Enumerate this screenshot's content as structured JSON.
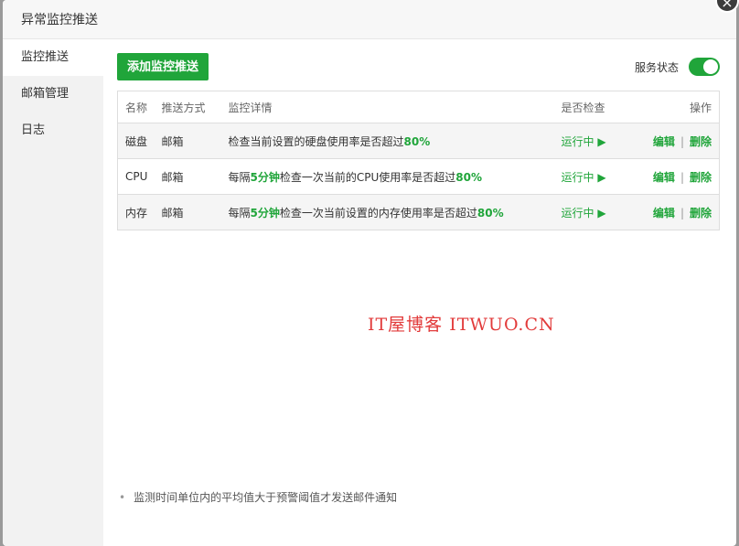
{
  "dialog": {
    "title": "异常监控推送",
    "close_icon": "close-icon"
  },
  "sidebar": {
    "items": [
      {
        "label": "监控推送"
      },
      {
        "label": "邮箱管理"
      },
      {
        "label": "日志"
      }
    ]
  },
  "toolbar": {
    "add_label": "添加监控推送",
    "service_label": "服务状态",
    "service_on": true
  },
  "table": {
    "headers": [
      "名称",
      "推送方式",
      "监控详情",
      "是否检查",
      "操作"
    ],
    "rows": [
      {
        "name": "磁盘",
        "type": "邮箱",
        "detail_a": "检查当前设置的硬盘使用率是否超过",
        "detail_hl": "80%",
        "detail_b": "",
        "detail_c": "",
        "status": "运行中 ▶",
        "edit": "编辑",
        "sep": "|",
        "del": "删除"
      },
      {
        "name": "CPU",
        "type": "邮箱",
        "detail_a": "每隔",
        "detail_hl": "5分钟",
        "detail_b": "检查一次当前的CPU使用率是否超过",
        "detail_c": "80%",
        "status": "运行中 ▶",
        "edit": "编辑",
        "sep": "|",
        "del": "删除"
      },
      {
        "name": "内存",
        "type": "邮箱",
        "detail_a": "每隔",
        "detail_hl": "5分钟",
        "detail_b": "检查一次当前设置的内存使用率是否超过",
        "detail_c": "80%",
        "status": "运行中 ▶",
        "edit": "编辑",
        "sep": "|",
        "del": "删除"
      }
    ]
  },
  "watermark": "IT屋博客 ITWUO.CN",
  "note": "监测时间单位内的平均值大于预警阈值才发送邮件通知",
  "colors": {
    "accent": "#20a53a",
    "watermark": "#e23b3b"
  }
}
